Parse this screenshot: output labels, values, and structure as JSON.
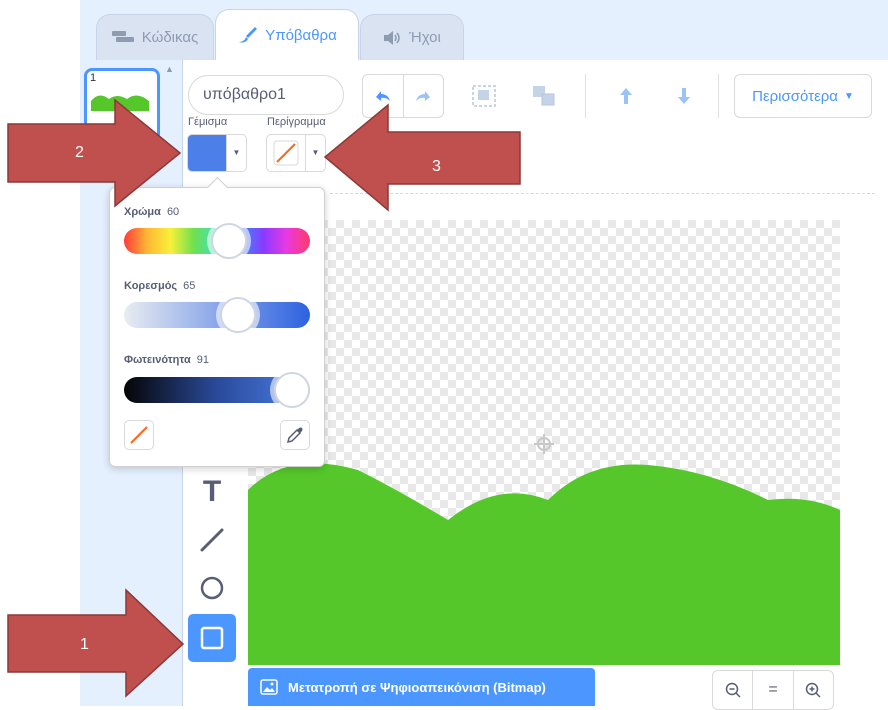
{
  "tabs": [
    {
      "label": "Κώδικας",
      "icon": "code-icon",
      "active": false
    },
    {
      "label": "Υπόβαθρα",
      "icon": "paintbrush-icon",
      "active": true
    },
    {
      "label": "Ήχοι",
      "icon": "speaker-icon",
      "active": false
    }
  ],
  "backdrop_list": {
    "number": "1"
  },
  "editor": {
    "name_value": "υπόβαθρο1",
    "more_label": "Περισσότερα",
    "fill_label": "Γέμισμα",
    "outline_label": "Περίγραμμα"
  },
  "color_popover": {
    "color_label": "Χρώμα",
    "color_value": "60",
    "saturation_label": "Κορεσμός",
    "saturation_value": "65",
    "brightness_label": "Φωτεινότητα",
    "brightness_value": "91"
  },
  "convert_button": {
    "label": "Μετατροπή σε Ψηφιοαπεικόνιση (Bitmap)"
  },
  "zoom": {
    "reset_label": "="
  },
  "annotations": [
    {
      "number": "1"
    },
    {
      "number": "2"
    },
    {
      "number": "3"
    }
  ],
  "colors": {
    "accent": "#4c97ff",
    "fill_swatch": "#4c7fe8",
    "grass": "#55c72b",
    "arrow": "#c0504d",
    "arrow_border": "#8c3836"
  }
}
